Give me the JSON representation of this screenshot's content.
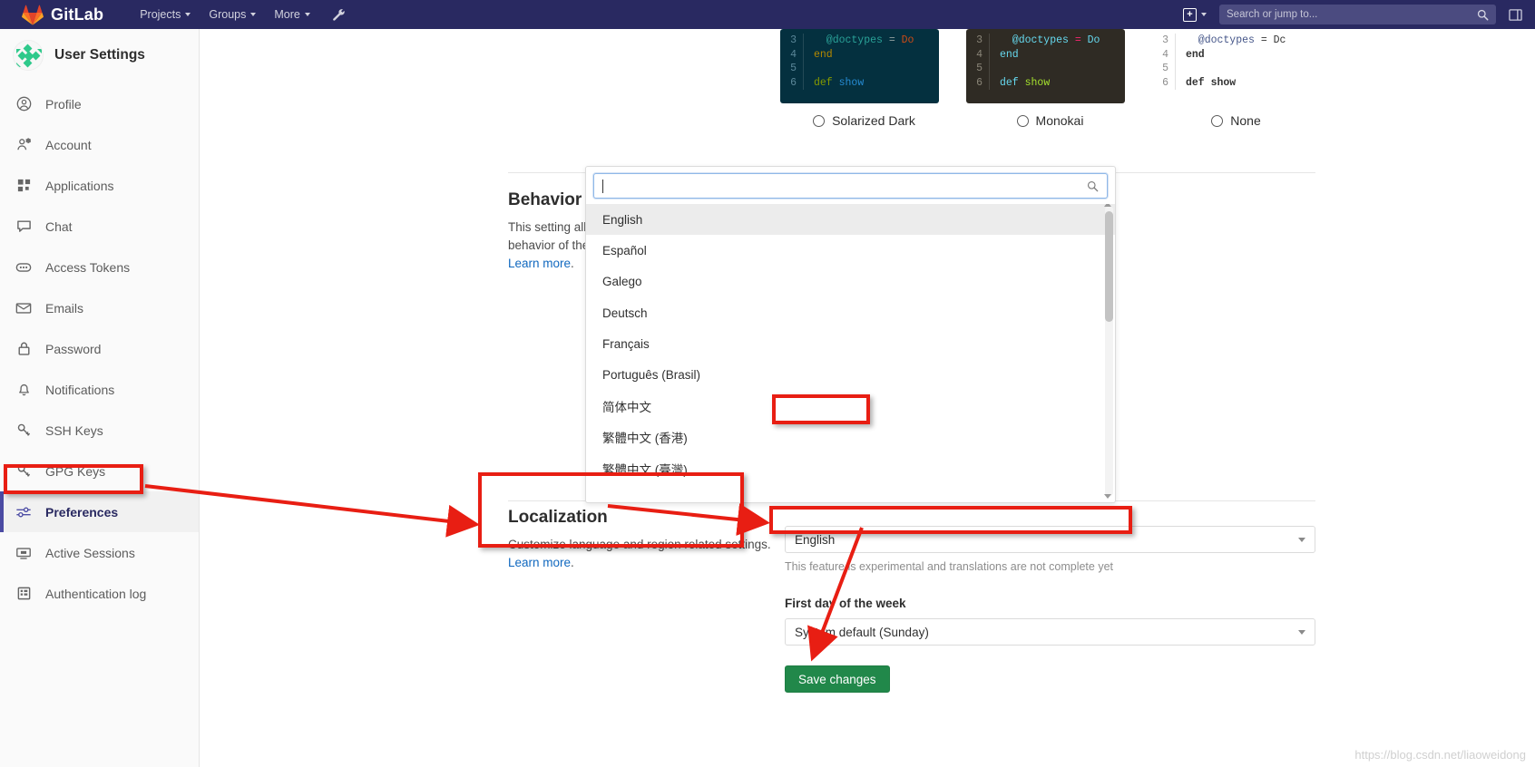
{
  "topbar": {
    "brand": "GitLab",
    "nav": [
      {
        "label": "Projects",
        "caret": true
      },
      {
        "label": "Groups",
        "caret": true
      },
      {
        "label": "More",
        "caret": true
      }
    ],
    "wrench_icon": "wrench-icon",
    "plus_label": "+",
    "search_placeholder": "Search or jump to...",
    "search_icon": "search-icon",
    "sidebar_toggle_icon": "sidebar-toggle-icon"
  },
  "sidebar": {
    "title": "User Settings",
    "avatar_icon": "user-avatar",
    "items": [
      {
        "label": "Profile",
        "icon": "user-circle-icon",
        "active": false
      },
      {
        "label": "Account",
        "icon": "account-gear-icon",
        "active": false
      },
      {
        "label": "Applications",
        "icon": "applications-grid-icon",
        "active": false
      },
      {
        "label": "Chat",
        "icon": "chat-bubble-icon",
        "active": false
      },
      {
        "label": "Access Tokens",
        "icon": "token-icon",
        "active": false
      },
      {
        "label": "Emails",
        "icon": "envelope-icon",
        "active": false
      },
      {
        "label": "Password",
        "icon": "lock-icon",
        "active": false
      },
      {
        "label": "Notifications",
        "icon": "bell-icon",
        "active": false
      },
      {
        "label": "SSH Keys",
        "icon": "key-icon",
        "active": false
      },
      {
        "label": "GPG Keys",
        "icon": "key-icon",
        "active": false
      },
      {
        "label": "Preferences",
        "icon": "preferences-sliders-icon",
        "active": true
      },
      {
        "label": "Active Sessions",
        "icon": "monitor-icon",
        "active": false
      },
      {
        "label": "Authentication log",
        "icon": "log-list-icon",
        "active": false
      }
    ]
  },
  "themes": [
    {
      "name": "Solarized Dark",
      "selected": false,
      "lines": [
        {
          "no": "3",
          "text": "@doctypes = Do"
        },
        {
          "no": "4",
          "text": "end"
        },
        {
          "no": "5",
          "text": ""
        },
        {
          "no": "6",
          "text": "def show"
        }
      ]
    },
    {
      "name": "Monokai",
      "selected": false,
      "lines": [
        {
          "no": "3",
          "text": "@doctypes = Do"
        },
        {
          "no": "4",
          "text": "end"
        },
        {
          "no": "5",
          "text": ""
        },
        {
          "no": "6",
          "text": "def show"
        }
      ]
    },
    {
      "name": "None",
      "selected": false,
      "lines": [
        {
          "no": "3",
          "text": "@doctypes = Dc"
        },
        {
          "no": "4",
          "text": "end"
        },
        {
          "no": "5",
          "text": ""
        },
        {
          "no": "6",
          "text": "def show"
        }
      ]
    }
  ],
  "behavior": {
    "title": "Behavior",
    "desc": "This setting allows you to customize the behavior of the system layout and default views.",
    "learn_more": "Learn more",
    "learn_more_suffix": "."
  },
  "localization": {
    "title": "Localization",
    "desc": "Customize language and region related settings.",
    "learn_more": "Learn more",
    "learn_more_suffix": ".",
    "language_value": "English",
    "language_hint": "This feature is experimental and translations are not complete yet",
    "first_day_label": "First day of the week",
    "first_day_value": "System default (Sunday)",
    "save_label": "Save changes"
  },
  "language_dropdown": {
    "search_value": "",
    "search_icon": "search-icon",
    "options": [
      {
        "label": "English",
        "highlighted": true,
        "annotated": false
      },
      {
        "label": "Español",
        "highlighted": false,
        "annotated": false
      },
      {
        "label": "Galego",
        "highlighted": false,
        "annotated": false
      },
      {
        "label": "Deutsch",
        "highlighted": false,
        "annotated": false
      },
      {
        "label": "Français",
        "highlighted": false,
        "annotated": false
      },
      {
        "label": "Português (Brasil)",
        "highlighted": false,
        "annotated": false
      },
      {
        "label": "简体中文",
        "highlighted": false,
        "annotated": true
      },
      {
        "label": "繁體中文 (香港)",
        "highlighted": false,
        "annotated": false
      },
      {
        "label": "繁體中文 (臺灣)",
        "highlighted": false,
        "annotated": false
      }
    ]
  },
  "watermark": "https://blog.csdn.net/liaoweidong",
  "colors": {
    "brand_navy": "#292961",
    "accent_blue": "#1068bf",
    "annotation_red": "#e81e13",
    "save_green": "#21884a",
    "active_border": "#4b4ba3"
  }
}
